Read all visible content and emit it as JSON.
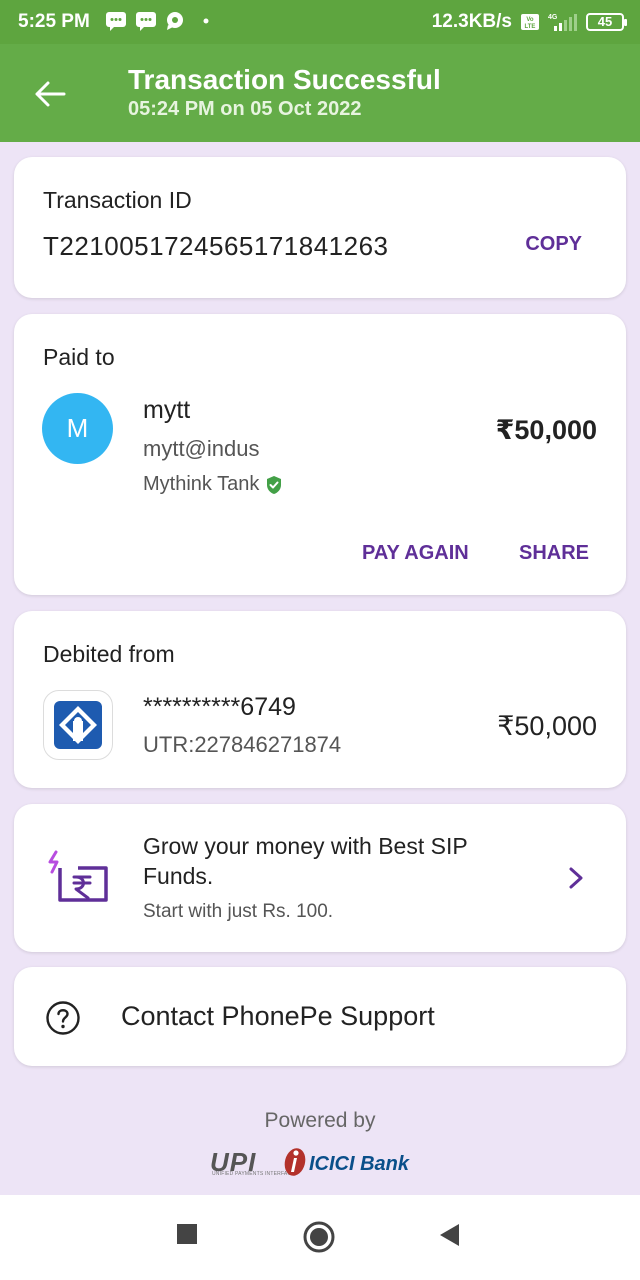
{
  "status_bar": {
    "time": "5:25 PM",
    "network_speed": "12.3KB/s",
    "volte": "VoLTE",
    "network_type": "4G",
    "battery": "45",
    "notification_icons": [
      "sms-icon",
      "sms-icon",
      "chat-icon",
      "dot-icon"
    ]
  },
  "header": {
    "title": "Transaction Successful",
    "subtitle": "05:24 PM on 05 Oct 2022",
    "bg_color": "#64ac48"
  },
  "transaction": {
    "label": "Transaction ID",
    "id": "T2210051724565171841263",
    "copy_label": "COPY"
  },
  "paid_to": {
    "label": "Paid to",
    "avatar_initial": "M",
    "name": "mytt",
    "upi_id": "mytt@indus",
    "merchant": "Mythink Tank",
    "amount": "₹50,000",
    "pay_again_label": "PAY AGAIN",
    "share_label": "SHARE"
  },
  "debited_from": {
    "label": "Debited from",
    "account": "**********6749",
    "utr": "UTR:227846271874",
    "amount": "₹50,000"
  },
  "promo": {
    "title": "Grow your money with Best SIP Funds.",
    "subtitle": "Start with just Rs. 100."
  },
  "support": {
    "label": "Contact PhonePe Support"
  },
  "footer": {
    "powered_by": "Powered by",
    "upi_logo_text": "UPI",
    "upi_tagline": "UNIFIED PAYMENTS INTERFACE",
    "bank_name": "ICICI Bank"
  },
  "colors": {
    "accent": "#5f2f98",
    "page_bg": "#ede4f6",
    "avatar": "#33b6f2",
    "verified": "#43a047"
  }
}
